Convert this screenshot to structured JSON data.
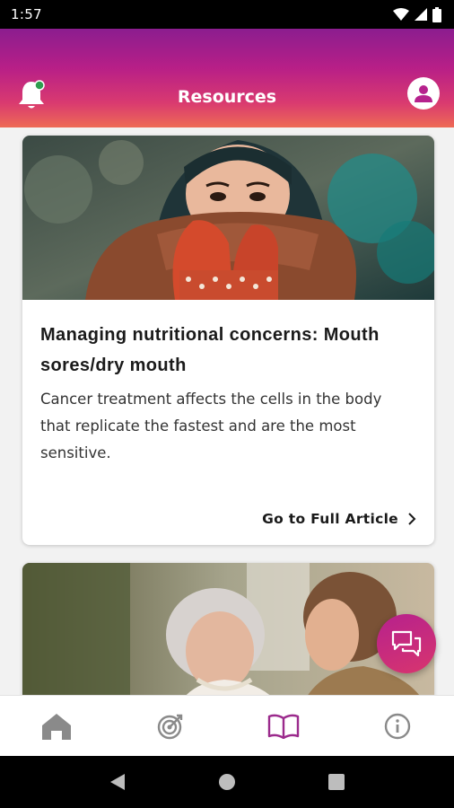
{
  "status_bar": {
    "time": "1:57",
    "icons": [
      "wifi-icon",
      "signal-icon",
      "battery-icon"
    ]
  },
  "header": {
    "title": "Resources",
    "left_icon": "bell-icon",
    "right_icon": "profile-icon",
    "notification_dot_color": "#2e9e4f"
  },
  "articles": [
    {
      "title": "Managing nutritional concerns: Mouth sores/dry mouth",
      "summary": "Cancer treatment affects the cells in the body that replicate the fastest and are the most sensitive.",
      "link_label": "Go to Full Article",
      "image": "woman-with-scarf-photo"
    },
    {
      "image": "elderly-women-photo"
    }
  ],
  "chat_fab": {
    "icon": "chat-icon"
  },
  "bottom_nav": [
    {
      "icon": "home-icon",
      "active": false
    },
    {
      "icon": "target-icon",
      "active": false
    },
    {
      "icon": "book-icon",
      "active": true
    },
    {
      "icon": "info-icon",
      "active": false
    }
  ],
  "colors": {
    "brand_purple": "#8b1d8f",
    "brand_pink": "#d8356e",
    "active_nav": "#9b2a8c",
    "inactive_nav": "#8a8a8a"
  }
}
